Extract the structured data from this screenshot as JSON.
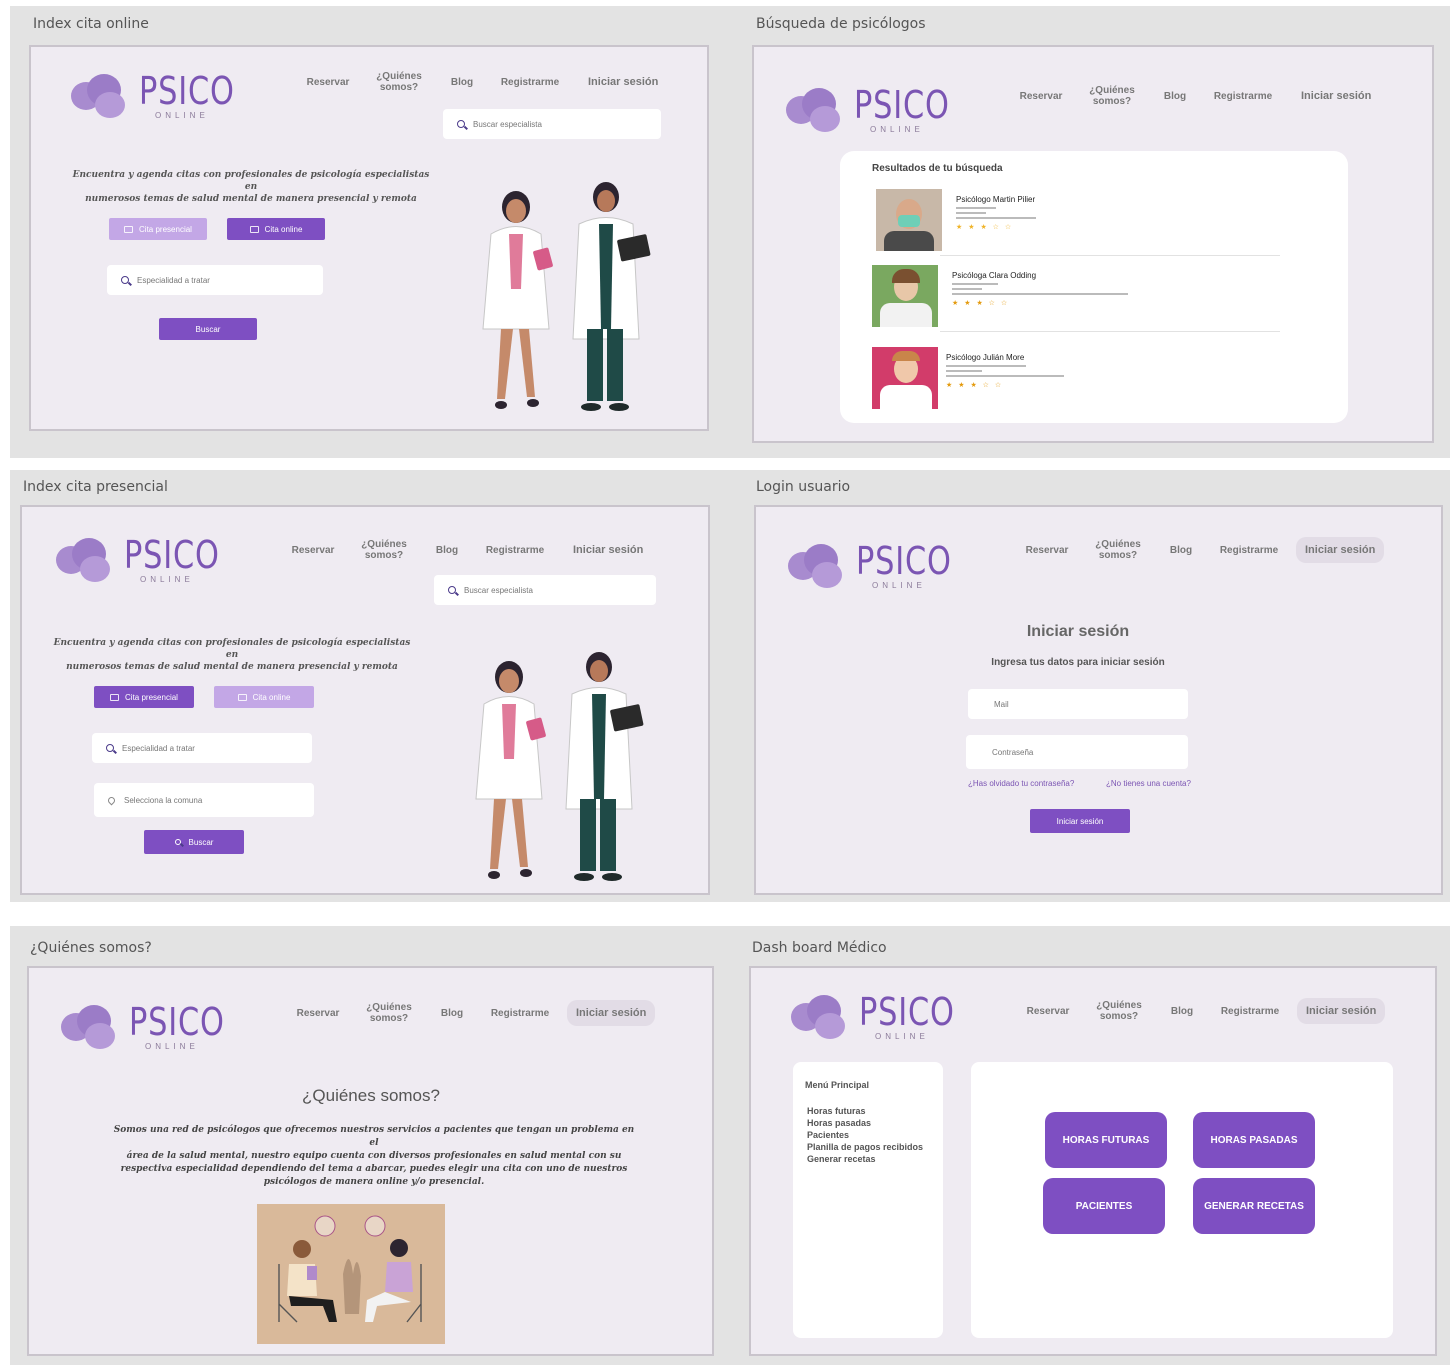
{
  "brand": {
    "main": "PSICO",
    "sub": "ONLINE"
  },
  "nav": {
    "reservar": "Reservar",
    "quienes_1": "¿Quiénes",
    "quienes_2": "somos?",
    "blog": "Blog",
    "registrarme": "Registrarme",
    "login": "Iniciar sesión"
  },
  "colors": {
    "accent": "#7e4fc2",
    "accent_light": "#c3a7e6",
    "frame_bg": "#efebf2",
    "board_bg": "#e3e3e3"
  },
  "boards": {
    "online": {
      "title": "Index cita online"
    },
    "busqueda": {
      "title": "Búsqueda de psicólogos"
    },
    "presencial": {
      "title": "Index cita presencial"
    },
    "login": {
      "title": "Login usuario"
    },
    "quienes": {
      "title": "¿Quiénes somos?"
    },
    "dashboard": {
      "title": "Dash board Médico"
    }
  },
  "index": {
    "search_placeholder": "Buscar especialista",
    "tagline_1": "Encuentra y agenda citas con profesionales de psicología especialistas en",
    "tagline_2": "numerosos temas de salud mental de manera presencial y remota",
    "btn_presencial": "Cita presencial",
    "btn_online": "Cita online",
    "especialidad_placeholder": "Especialidad a tratar",
    "comuna_placeholder": "Selecciona la comuna",
    "buscar": "Buscar"
  },
  "busqueda": {
    "results_title": "Resultados de tu búsqueda",
    "results": [
      {
        "name": "Psicólogo Martin Pilier",
        "stars": "★ ★ ★ ☆ ☆"
      },
      {
        "name": "Psicóloga Clara Odding",
        "stars": "★ ★ ★ ☆ ☆"
      },
      {
        "name": "Psicólogo Julián More",
        "stars": "★ ★ ★ ☆ ☆"
      }
    ]
  },
  "login": {
    "title": "Iniciar sesión",
    "subtitle": "Ingresa tus datos para iniciar sesión",
    "mail": "Mail",
    "password": "Contraseña",
    "forgot": "¿Has olvidado tu contraseña?",
    "no_account": "¿No tienes una cuenta?",
    "submit": "Iniciar sesión"
  },
  "quienes": {
    "title": "¿Quiénes somos?",
    "text_1": "Somos una red de psicólogos que ofrecemos nuestros servicios a pacientes que tengan un problema en el",
    "text_2": "área de la salud mental, nuestro equipo cuenta con diversos profesionales en salud mental con su",
    "text_3": "respectiva especialidad dependiendo del tema a abarcar, puedes elegir una cita con uno de nuestros",
    "text_4": "psicólogos de manera online y/o presencial."
  },
  "dashboard": {
    "menu_title": "Menú Principal",
    "menu_items": [
      "Horas futuras",
      "Horas pasadas",
      "Pacientes",
      "Planilla de pagos recibidos",
      "Generar recetas"
    ],
    "buttons": [
      "HORAS FUTURAS",
      "HORAS PASADAS",
      "PACIENTES",
      "GENERAR RECETAS"
    ]
  }
}
